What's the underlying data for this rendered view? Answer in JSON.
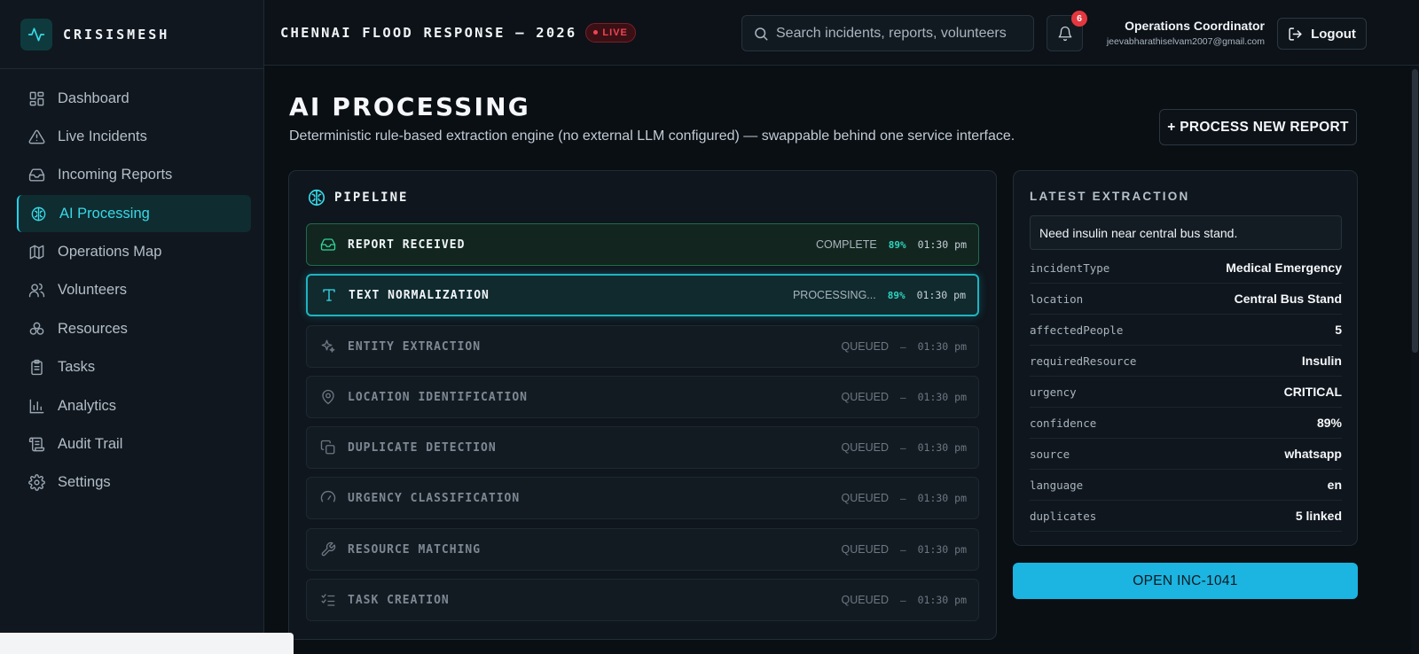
{
  "brand": {
    "name": "CRISISMESH"
  },
  "sidebar": {
    "items": [
      {
        "label": "Dashboard",
        "icon": "dashboard-icon"
      },
      {
        "label": "Live Incidents",
        "icon": "alert-triangle-icon"
      },
      {
        "label": "Incoming Reports",
        "icon": "inbox-icon"
      },
      {
        "label": "AI Processing",
        "icon": "brain-icon",
        "active": true
      },
      {
        "label": "Operations Map",
        "icon": "map-icon"
      },
      {
        "label": "Volunteers",
        "icon": "users-icon"
      },
      {
        "label": "Resources",
        "icon": "boxes-icon"
      },
      {
        "label": "Tasks",
        "icon": "clipboard-icon"
      },
      {
        "label": "Analytics",
        "icon": "bar-chart-icon"
      },
      {
        "label": "Audit Trail",
        "icon": "scroll-icon"
      },
      {
        "label": "Settings",
        "icon": "gear-icon"
      }
    ]
  },
  "header": {
    "operation_title": "CHENNAI FLOOD RESPONSE — 2026",
    "live_label": "LIVE",
    "search_placeholder": "Search incidents, reports, volunteers",
    "notification_count": "6",
    "user_role": "Operations Coordinator",
    "user_email": "jeevabharathiselvam2007@gmail.com",
    "logout_label": "Logout"
  },
  "page": {
    "title": "AI PROCESSING",
    "subtitle": "Deterministic rule-based extraction engine (no external LLM configured) — swappable behind one service interface.",
    "process_button": "+ PROCESS NEW REPORT"
  },
  "pipeline": {
    "title": "PIPELINE",
    "steps": [
      {
        "label": "REPORT RECEIVED",
        "status": "COMPLETE",
        "pct": "89%",
        "time": "01:30 pm",
        "state": "complete",
        "icon": "inbox-icon"
      },
      {
        "label": "TEXT NORMALIZATION",
        "status": "PROCESSING...",
        "pct": "89%",
        "time": "01:30 pm",
        "state": "processing",
        "icon": "text-icon"
      },
      {
        "label": "ENTITY EXTRACTION",
        "status": "QUEUED",
        "pct": "—",
        "time": "01:30 pm",
        "state": "queued",
        "icon": "sparkles-icon"
      },
      {
        "label": "LOCATION IDENTIFICATION",
        "status": "QUEUED",
        "pct": "—",
        "time": "01:30 pm",
        "state": "queued",
        "icon": "map-pin-icon"
      },
      {
        "label": "DUPLICATE DETECTION",
        "status": "QUEUED",
        "pct": "—",
        "time": "01:30 pm",
        "state": "queued",
        "icon": "copy-icon"
      },
      {
        "label": "URGENCY CLASSIFICATION",
        "status": "QUEUED",
        "pct": "—",
        "time": "01:30 pm",
        "state": "queued",
        "icon": "gauge-icon"
      },
      {
        "label": "RESOURCE MATCHING",
        "status": "QUEUED",
        "pct": "—",
        "time": "01:30 pm",
        "state": "queued",
        "icon": "wrench-icon"
      },
      {
        "label": "TASK CREATION",
        "status": "QUEUED",
        "pct": "—",
        "time": "01:30 pm",
        "state": "queued",
        "icon": "list-checks-icon"
      }
    ]
  },
  "extraction": {
    "title": "LATEST EXTRACTION",
    "text": "Need insulin near central bus stand.",
    "fields": [
      {
        "key": "incidentType",
        "value": "Medical Emergency"
      },
      {
        "key": "location",
        "value": "Central Bus Stand"
      },
      {
        "key": "affectedPeople",
        "value": "5"
      },
      {
        "key": "requiredResource",
        "value": "Insulin"
      },
      {
        "key": "urgency",
        "value": "CRITICAL"
      },
      {
        "key": "confidence",
        "value": "89%"
      },
      {
        "key": "source",
        "value": "whatsapp"
      },
      {
        "key": "language",
        "value": "en"
      },
      {
        "key": "duplicates",
        "value": "5 linked"
      }
    ],
    "open_button": "OPEN INC-1041"
  },
  "colors": {
    "accent": "#22d3ee",
    "complete": "#34d399",
    "live": "#f04452",
    "open_button": "#1cb4e0"
  }
}
